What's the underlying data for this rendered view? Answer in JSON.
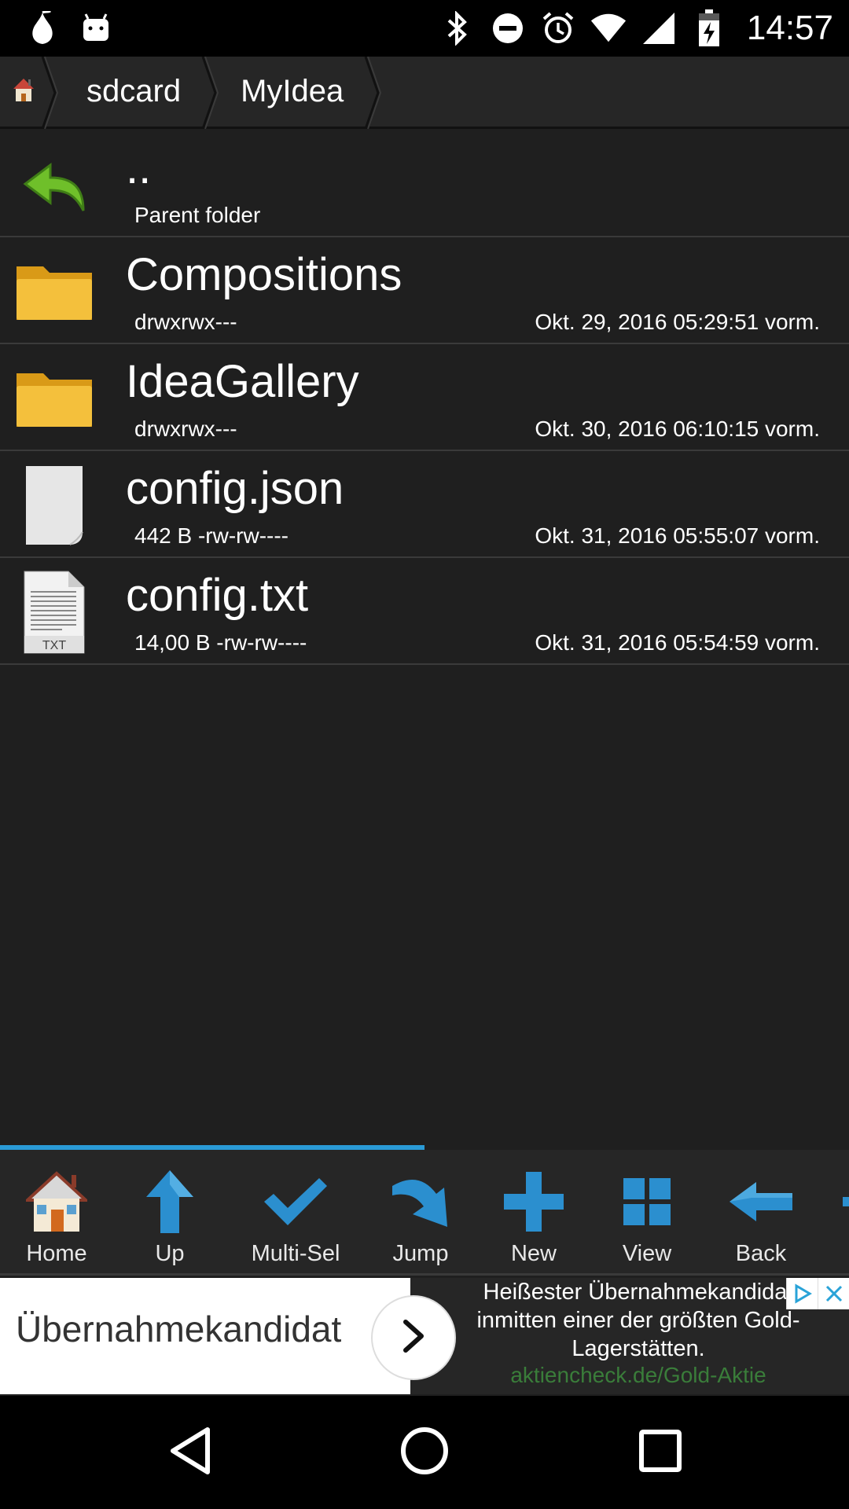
{
  "status_bar": {
    "time": "14:57",
    "icons": [
      "app-drop-icon",
      "android-icon",
      "bluetooth-icon",
      "do-not-disturb-icon",
      "alarm-icon",
      "wifi-icon",
      "signal-icon",
      "battery-charging-icon"
    ]
  },
  "breadcrumb": {
    "home_icon": "home-icon",
    "items": [
      "sdcard",
      "MyIdea"
    ]
  },
  "files": [
    {
      "name": "..",
      "meta": "Parent folder",
      "date": "",
      "icon": "parent-folder-icon"
    },
    {
      "name": "Compositions",
      "meta": "drwxrwx---",
      "date": "Okt. 29, 2016 05:29:51 vorm.",
      "icon": "folder-icon"
    },
    {
      "name": "IdeaGallery",
      "meta": "drwxrwx---",
      "date": "Okt. 30, 2016 06:10:15 vorm.",
      "icon": "folder-icon"
    },
    {
      "name": "config.json",
      "meta": "442 B -rw-rw----",
      "date": "Okt. 31, 2016 05:55:07 vorm.",
      "icon": "file-icon"
    },
    {
      "name": "config.txt",
      "meta": "14,00 B -rw-rw----",
      "date": "Okt. 31, 2016 05:54:59 vorm.",
      "icon": "txt-file-icon"
    }
  ],
  "toolbar": {
    "progress": 0.5,
    "items": [
      {
        "label": "Home",
        "icon": "home-icon"
      },
      {
        "label": "Up",
        "icon": "up-arrow-icon"
      },
      {
        "label": "Multi-Sel",
        "icon": "checkmark-icon"
      },
      {
        "label": "Jump",
        "icon": "jump-arrow-icon"
      },
      {
        "label": "New",
        "icon": "plus-icon"
      },
      {
        "label": "View",
        "icon": "grid-icon"
      },
      {
        "label": "Back",
        "icon": "back-arrow-icon"
      }
    ]
  },
  "ad": {
    "title": "Übernahmekandidat",
    "text": "Heißester Übernahmekandidat inmitten einer der größten Gold-Lagerstätten.",
    "link": "aktiencheck.de/Gold-Aktie"
  },
  "navbar": {
    "icons": [
      "back-triangle-icon",
      "home-circle-icon",
      "recents-square-icon"
    ]
  },
  "colors": {
    "accent": "#2a9ad6",
    "background": "#1f1f1f",
    "folder": "#f2b82e",
    "ad_link": "#3a7d3a"
  }
}
